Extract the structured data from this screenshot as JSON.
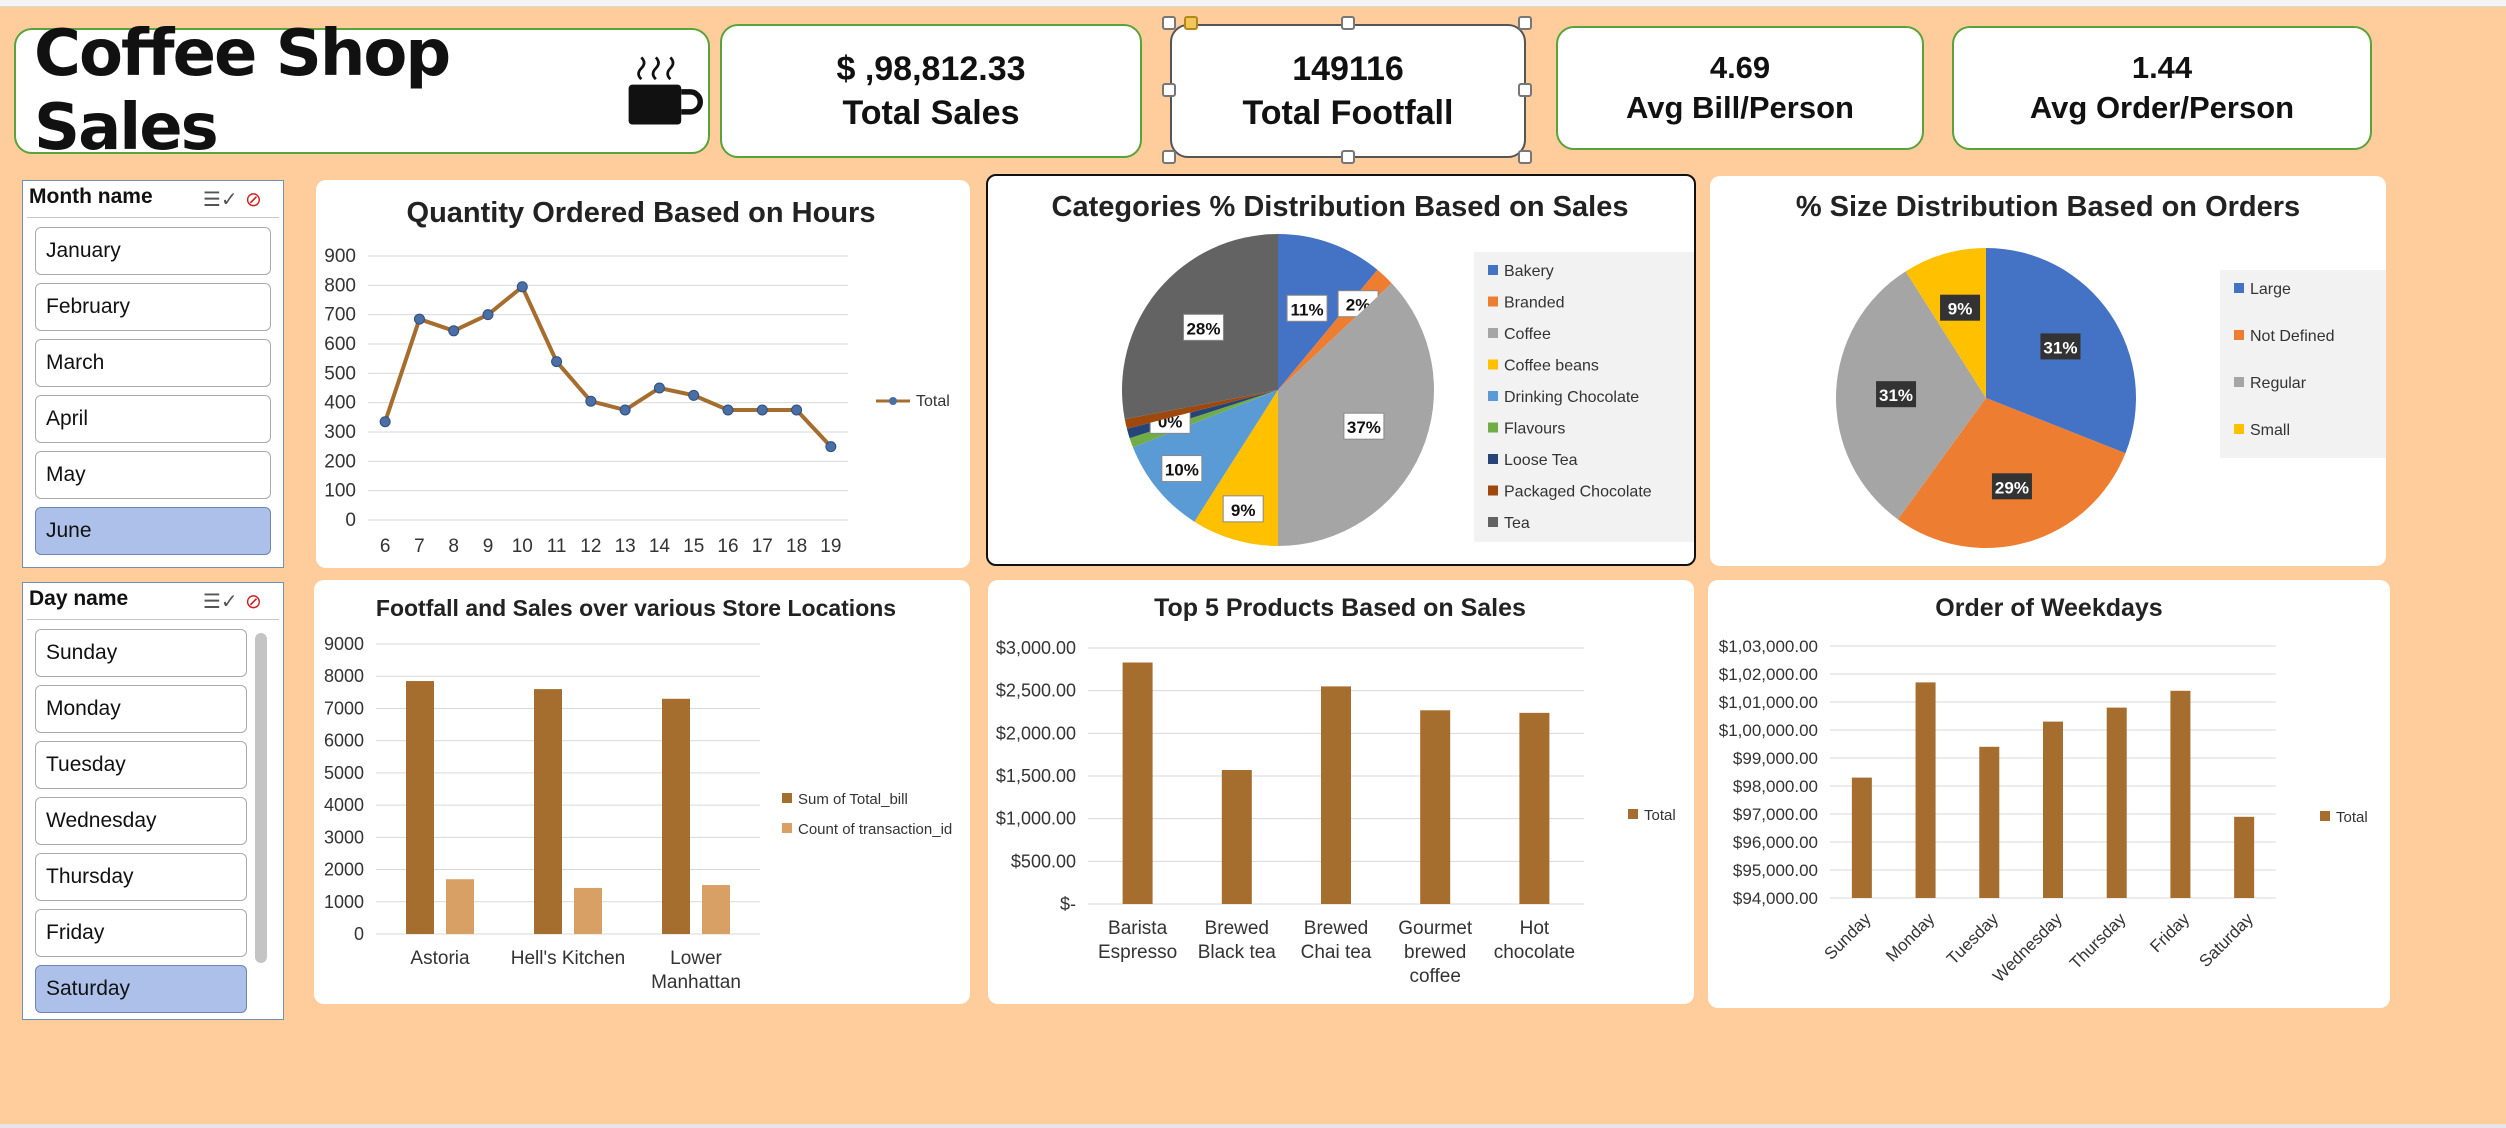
{
  "title": "Coffee Shop Sales",
  "kpis": {
    "total_sales": {
      "value": "$ ,98,812.33",
      "label": "Total Sales"
    },
    "total_footfall": {
      "value": "149116",
      "label": "Total Footfall"
    },
    "avg_bill": {
      "value": "4.69",
      "label": "Avg Bill/Person"
    },
    "avg_order": {
      "value": "1.44",
      "label": "Avg Order/Person"
    }
  },
  "month_slicer": {
    "header": "Month name",
    "items": [
      "January",
      "February",
      "March",
      "April",
      "May",
      "June"
    ],
    "selected": "June"
  },
  "day_slicer": {
    "header": "Day name",
    "items": [
      "Sunday",
      "Monday",
      "Tuesday",
      "Wednesday",
      "Thursday",
      "Friday",
      "Saturday"
    ],
    "selected": "Saturday"
  },
  "icons": [
    "coffee-cup-icon",
    "multi-select-icon",
    "clear-filter-icon"
  ],
  "colors": {
    "background": "#FFCD9C",
    "bar_brown": "#A56D2E",
    "bar_tan": "#D9A066",
    "line": "#A56D2E",
    "kpi_border": "#5AA23A",
    "slicer_selected": "#ADC0EA"
  },
  "chart_data": [
    {
      "id": "hours",
      "type": "line",
      "title": "Quantity Ordered Based on Hours",
      "x": [
        "6",
        "7",
        "8",
        "9",
        "10",
        "11",
        "12",
        "13",
        "14",
        "15",
        "16",
        "17",
        "18",
        "19"
      ],
      "series": [
        {
          "name": "Total",
          "values": [
            335,
            685,
            645,
            700,
            795,
            540,
            405,
            375,
            450,
            425,
            375,
            375,
            375,
            250
          ]
        }
      ],
      "ylim": [
        0,
        900
      ],
      "yticks": [
        "0",
        "100",
        "200",
        "300",
        "400",
        "500",
        "600",
        "700",
        "800",
        "900"
      ],
      "legend": "right",
      "grid": true
    },
    {
      "id": "categories",
      "type": "pie",
      "title": "Categories % Distribution Based on Sales",
      "labels": [
        "Bakery",
        "Branded",
        "Coffee",
        "Coffee beans",
        "Drinking Chocolate",
        "Flavours",
        "Loose Tea",
        "Packaged Chocolate",
        "Tea"
      ],
      "values": [
        11,
        2,
        37,
        9,
        10,
        1,
        1,
        1,
        28
      ],
      "data_labels": [
        "11%",
        "2%",
        "37%",
        "9%",
        "10%",
        "",
        "0%",
        "",
        "28%"
      ],
      "colors": [
        "#4472C4",
        "#ED7D31",
        "#A5A5A5",
        "#FFC000",
        "#5B9BD5",
        "#70AD47",
        "#264478",
        "#9E480E",
        "#636363"
      ],
      "legend": "right"
    },
    {
      "id": "sizes",
      "type": "pie",
      "title": "% Size Distribution Based on Orders",
      "labels": [
        "Large",
        "Not Defined",
        "Regular",
        "Small"
      ],
      "values": [
        31,
        29,
        31,
        9
      ],
      "data_labels": [
        "31%",
        "29%",
        "31%",
        "9%"
      ],
      "colors": [
        "#4472C4",
        "#ED7D31",
        "#A5A5A5",
        "#FFC000"
      ],
      "legend": "right"
    },
    {
      "id": "locations",
      "type": "bar",
      "title": "Footfall and Sales over various Store Locations",
      "categories": [
        "Astoria",
        "Hell's Kitchen",
        "Lower Manhattan"
      ],
      "series": [
        {
          "name": "Sum of Total_bill",
          "values": [
            7850,
            7600,
            7300
          ]
        },
        {
          "name": "Count of transaction_id",
          "values": [
            1700,
            1430,
            1520
          ]
        }
      ],
      "ylim": [
        0,
        9000
      ],
      "yticks": [
        "0",
        "1000",
        "2000",
        "3000",
        "4000",
        "5000",
        "6000",
        "7000",
        "8000",
        "9000"
      ],
      "legend": "right"
    },
    {
      "id": "products",
      "type": "bar",
      "title": "Top 5 Products Based on Sales",
      "categories": [
        "Barista Espresso",
        "Brewed Black tea",
        "Brewed Chai tea",
        "Gourmet brewed coffee",
        "Hot chocolate"
      ],
      "series": [
        {
          "name": "Total",
          "values": [
            2830,
            1570,
            2550,
            2270,
            2240
          ]
        }
      ],
      "ylim": [
        0,
        3000
      ],
      "yticks": [
        "$-",
        "$500.00",
        "$1,000.00",
        "$1,500.00",
        "$2,000.00",
        "$2,500.00",
        "$3,000.00"
      ],
      "legend": "right"
    },
    {
      "id": "weekdays",
      "type": "bar",
      "title": "Order of Weekdays",
      "categories": [
        "Sunday",
        "Monday",
        "Tuesday",
        "Wednesday",
        "Thursday",
        "Friday",
        "Saturday"
      ],
      "series": [
        {
          "name": "Total",
          "values": [
            98300,
            101700,
            99400,
            100300,
            100800,
            101400,
            96900
          ]
        }
      ],
      "ylim": [
        94000,
        103000
      ],
      "yticks": [
        "$94,000.00",
        "$95,000.00",
        "$96,000.00",
        "$97,000.00",
        "$98,000.00",
        "$99,000.00",
        "$1,00,000.00",
        "$1,01,000.00",
        "$1,02,000.00",
        "$1,03,000.00"
      ],
      "legend": "right"
    }
  ]
}
